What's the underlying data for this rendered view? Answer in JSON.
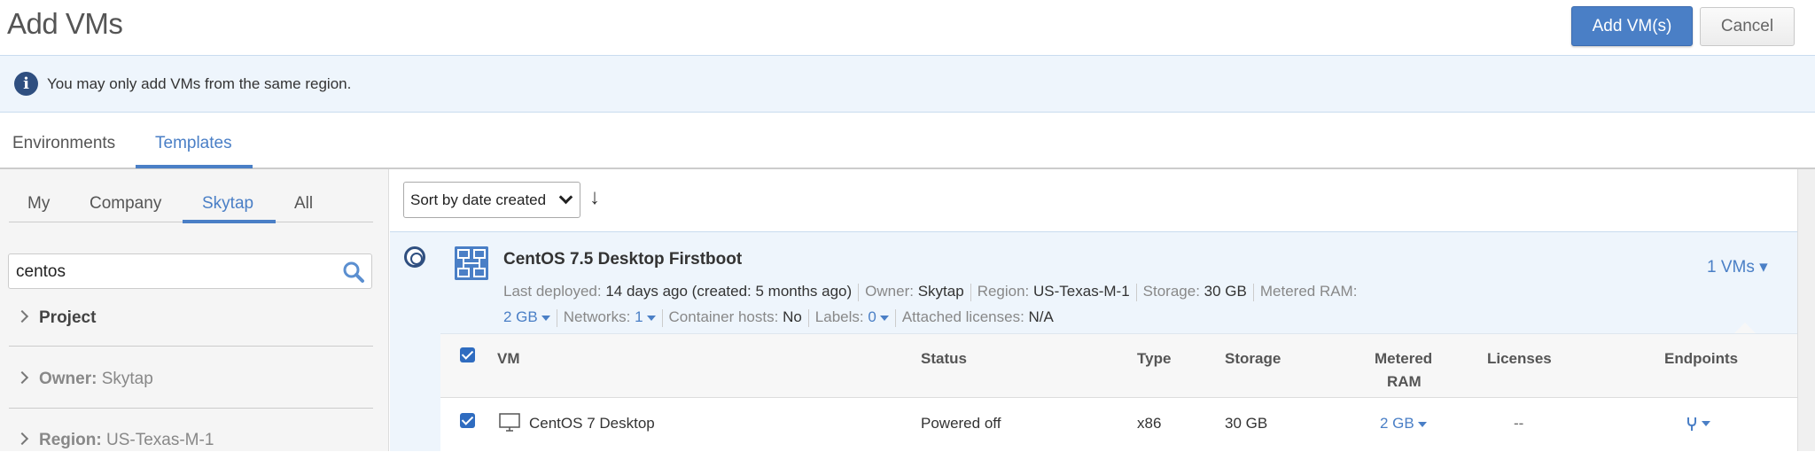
{
  "header": {
    "title": "Add VMs",
    "add_button": "Add VM(s)",
    "cancel_button": "Cancel"
  },
  "banner": {
    "icon": "info-icon",
    "text": "You may only add VMs from the same region."
  },
  "tabs": [
    {
      "label": "Environments",
      "active": false
    },
    {
      "label": "Templates",
      "active": true
    }
  ],
  "left_panel": {
    "subtabs": [
      {
        "label": "My"
      },
      {
        "label": "Company"
      },
      {
        "label": "Skytap",
        "active": true
      },
      {
        "label": "All"
      }
    ],
    "search": {
      "value": "centos",
      "placeholder": "Search"
    },
    "facets": [
      {
        "label": "Project",
        "value": ""
      },
      {
        "label": "Owner:",
        "value": "Skytap"
      },
      {
        "label": "Region:",
        "value": "US-Texas-M-1"
      }
    ]
  },
  "toolbar": {
    "sort_value": "Sort by date created",
    "sort_direction_icon": "arrow-down-icon"
  },
  "template": {
    "name": "CentOS 7.5 Desktop Firstboot",
    "last_deployed_label": "Last deployed:",
    "last_deployed_value": "14 days ago (created: 5 months ago)",
    "owner_label": "Owner:",
    "owner_value": "Skytap",
    "region_label": "Region:",
    "region_value": "US-Texas-M-1",
    "storage_label": "Storage:",
    "storage_value": "30 GB",
    "metered_ram_label": "Metered RAM:",
    "metered_ram_value": "2 GB",
    "networks_label": "Networks:",
    "networks_value": "1",
    "container_hosts_label": "Container hosts:",
    "container_hosts_value": "No",
    "labels_label": "Labels:",
    "labels_value": "0",
    "licenses_label": "Attached licenses:",
    "licenses_value": "N/A",
    "vms_link": "1 VMs ▾"
  },
  "vm_table": {
    "columns": [
      "VM",
      "Status",
      "Type",
      "Storage",
      "Metered",
      "RAM",
      "Licenses",
      "Endpoints"
    ],
    "rows": [
      {
        "checked": true,
        "vm": "CentOS 7 Desktop",
        "status": "Powered off",
        "type": "x86",
        "storage": "30 GB",
        "metered_ram": "2 GB",
        "licenses": "--",
        "endpoints_icon": "fork-icon"
      }
    ]
  },
  "colors": {
    "accent": "#4a7fc6",
    "banner_bg": "#eef5fc",
    "dark_blue": "#2f4f80"
  }
}
